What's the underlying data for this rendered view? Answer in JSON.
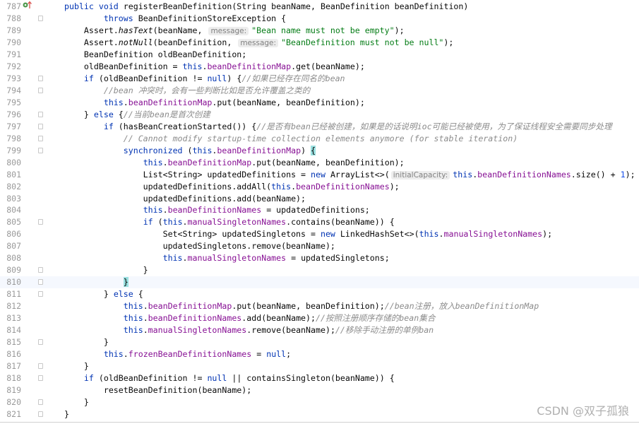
{
  "editor": {
    "colors": {
      "keyword": "#0033b3",
      "field": "#871094",
      "string": "#067d17",
      "comment": "#8c8c8c",
      "number": "#1750eb",
      "brace_match": "#99e0e0"
    },
    "current_line": 810,
    "lines": [
      {
        "n": "787",
        "icon": "override-implements-icon",
        "tokens": [
          [
            "k",
            "public void "
          ],
          [
            "t",
            "registerBeanDefinition(String beanName, BeanDefinition beanDefinition)"
          ]
        ]
      },
      {
        "n": "788",
        "fold": true,
        "tokens": [
          [
            "t",
            "        "
          ],
          [
            "k",
            "throws "
          ],
          [
            "t",
            "BeanDefinitionStoreException {"
          ]
        ]
      },
      {
        "n": "789",
        "tokens": [
          [
            "t",
            "    Assert."
          ],
          [
            "i",
            "hasText"
          ],
          [
            "t",
            "(beanName, "
          ],
          [
            "h",
            "message:"
          ],
          [
            "s",
            "\"Bean name must not be empty\""
          ],
          [
            "t",
            ");"
          ]
        ]
      },
      {
        "n": "790",
        "tokens": [
          [
            "t",
            "    Assert."
          ],
          [
            "i",
            "notNull"
          ],
          [
            "t",
            "(beanDefinition, "
          ],
          [
            "h",
            "message:"
          ],
          [
            "s",
            "\"BeanDefinition must not be null\""
          ],
          [
            "t",
            ");"
          ]
        ]
      },
      {
        "n": "791",
        "tokens": [
          [
            "t",
            "    BeanDefinition oldBeanDefinition;"
          ]
        ]
      },
      {
        "n": "792",
        "tokens": [
          [
            "t",
            "    oldBeanDefinition = "
          ],
          [
            "k",
            "this"
          ],
          [
            "t",
            "."
          ],
          [
            "f",
            "beanDefinitionMap"
          ],
          [
            "t",
            ".get(beanName);"
          ]
        ]
      },
      {
        "n": "793",
        "fold": true,
        "tokens": [
          [
            "t",
            "    "
          ],
          [
            "k",
            "if"
          ],
          [
            "t",
            " (oldBeanDefinition != "
          ],
          [
            "k",
            "null"
          ],
          [
            "t",
            ") {"
          ],
          [
            "c",
            "//如果已经存在同名的bean"
          ]
        ]
      },
      {
        "n": "794",
        "fold": true,
        "tokens": [
          [
            "t",
            "        "
          ],
          [
            "c",
            "//bean 冲突时，会有一些判断比如是否允许覆盖之类的"
          ]
        ]
      },
      {
        "n": "795",
        "tokens": [
          [
            "t",
            "        "
          ],
          [
            "k",
            "this"
          ],
          [
            "t",
            "."
          ],
          [
            "f",
            "beanDefinitionMap"
          ],
          [
            "t",
            ".put(beanName, beanDefinition);"
          ]
        ]
      },
      {
        "n": "796",
        "fold": true,
        "tokens": [
          [
            "t",
            "    } "
          ],
          [
            "k",
            "else"
          ],
          [
            "t",
            " {"
          ],
          [
            "c",
            "//当前bean是首次创建"
          ]
        ]
      },
      {
        "n": "797",
        "fold": true,
        "tokens": [
          [
            "t",
            "        "
          ],
          [
            "k",
            "if"
          ],
          [
            "t",
            " (hasBeanCreationStarted()) {"
          ],
          [
            "c",
            "//是否有bean已经被创建，如果是的话说明ioc可能已经被使用，为了保证线程安全需要同步处理"
          ]
        ]
      },
      {
        "n": "798",
        "fold": true,
        "tokens": [
          [
            "t",
            "            "
          ],
          [
            "c",
            "// Cannot modify startup-time collection elements anymore (for stable iteration)"
          ]
        ]
      },
      {
        "n": "799",
        "fold": true,
        "tokens": [
          [
            "t",
            "            "
          ],
          [
            "k",
            "synchronized"
          ],
          [
            "t",
            " ("
          ],
          [
            "k",
            "this"
          ],
          [
            "t",
            "."
          ],
          [
            "f",
            "beanDefinitionMap"
          ],
          [
            "t",
            ") "
          ],
          [
            "b",
            "{"
          ]
        ]
      },
      {
        "n": "800",
        "tokens": [
          [
            "t",
            "                "
          ],
          [
            "k",
            "this"
          ],
          [
            "t",
            "."
          ],
          [
            "f",
            "beanDefinitionMap"
          ],
          [
            "t",
            ".put(beanName, beanDefinition);"
          ]
        ]
      },
      {
        "n": "801",
        "tokens": [
          [
            "t",
            "                List<String> updatedDefinitions = "
          ],
          [
            "k",
            "new"
          ],
          [
            "t",
            " ArrayList<>("
          ],
          [
            "h",
            "initialCapacity:"
          ],
          [
            "k",
            "this"
          ],
          [
            "t",
            "."
          ],
          [
            "f",
            "beanDefinitionNames"
          ],
          [
            "t",
            ".size() + "
          ],
          [
            "n",
            "1"
          ],
          [
            "t",
            ");"
          ]
        ]
      },
      {
        "n": "802",
        "tokens": [
          [
            "t",
            "                updatedDefinitions.addAll("
          ],
          [
            "k",
            "this"
          ],
          [
            "t",
            "."
          ],
          [
            "f",
            "beanDefinitionNames"
          ],
          [
            "t",
            ");"
          ]
        ]
      },
      {
        "n": "803",
        "tokens": [
          [
            "t",
            "                updatedDefinitions.add(beanName);"
          ]
        ]
      },
      {
        "n": "804",
        "tokens": [
          [
            "t",
            "                "
          ],
          [
            "k",
            "this"
          ],
          [
            "t",
            "."
          ],
          [
            "f",
            "beanDefinitionNames"
          ],
          [
            "t",
            " = updatedDefinitions;"
          ]
        ]
      },
      {
        "n": "805",
        "fold": true,
        "tokens": [
          [
            "t",
            "                "
          ],
          [
            "k",
            "if"
          ],
          [
            "t",
            " ("
          ],
          [
            "k",
            "this"
          ],
          [
            "t",
            "."
          ],
          [
            "f",
            "manualSingletonNames"
          ],
          [
            "t",
            ".contains(beanName)) {"
          ]
        ]
      },
      {
        "n": "806",
        "tokens": [
          [
            "t",
            "                    Set<String> updatedSingletons = "
          ],
          [
            "k",
            "new"
          ],
          [
            "t",
            " LinkedHashSet<>("
          ],
          [
            "k",
            "this"
          ],
          [
            "t",
            "."
          ],
          [
            "f",
            "manualSingletonNames"
          ],
          [
            "t",
            ");"
          ]
        ]
      },
      {
        "n": "807",
        "tokens": [
          [
            "t",
            "                    updatedSingletons.remove(beanName);"
          ]
        ]
      },
      {
        "n": "808",
        "tokens": [
          [
            "t",
            "                    "
          ],
          [
            "k",
            "this"
          ],
          [
            "t",
            "."
          ],
          [
            "f",
            "manualSingletonNames"
          ],
          [
            "t",
            " = updatedSingletons;"
          ]
        ]
      },
      {
        "n": "809",
        "fold": true,
        "tokens": [
          [
            "t",
            "                }"
          ]
        ]
      },
      {
        "n": "810",
        "fold": true,
        "tokens": [
          [
            "t",
            "            "
          ],
          [
            "b",
            "}"
          ]
        ]
      },
      {
        "n": "811",
        "fold": true,
        "tokens": [
          [
            "t",
            "        } "
          ],
          [
            "k",
            "else"
          ],
          [
            "t",
            " {"
          ]
        ]
      },
      {
        "n": "812",
        "tokens": [
          [
            "t",
            "            "
          ],
          [
            "k",
            "this"
          ],
          [
            "t",
            "."
          ],
          [
            "f",
            "beanDefinitionMap"
          ],
          [
            "t",
            ".put(beanName, beanDefinition);"
          ],
          [
            "c",
            "//bean注册，放入beanDefinitionMap"
          ]
        ]
      },
      {
        "n": "813",
        "tokens": [
          [
            "t",
            "            "
          ],
          [
            "k",
            "this"
          ],
          [
            "t",
            "."
          ],
          [
            "f",
            "beanDefinitionNames"
          ],
          [
            "t",
            ".add(beanName);"
          ],
          [
            "c",
            "//按照注册顺序存储的bean集合"
          ]
        ]
      },
      {
        "n": "814",
        "tokens": [
          [
            "t",
            "            "
          ],
          [
            "k",
            "this"
          ],
          [
            "t",
            "."
          ],
          [
            "f",
            "manualSingletonNames"
          ],
          [
            "t",
            ".remove(beanName);"
          ],
          [
            "c",
            "//移除手动注册的单例ban"
          ]
        ]
      },
      {
        "n": "815",
        "fold": true,
        "tokens": [
          [
            "t",
            "        }"
          ]
        ]
      },
      {
        "n": "816",
        "tokens": [
          [
            "t",
            "        "
          ],
          [
            "k",
            "this"
          ],
          [
            "t",
            "."
          ],
          [
            "f",
            "frozenBeanDefinitionNames"
          ],
          [
            "t",
            " = "
          ],
          [
            "k",
            "null"
          ],
          [
            "t",
            ";"
          ]
        ]
      },
      {
        "n": "817",
        "fold": true,
        "tokens": [
          [
            "t",
            "    }"
          ]
        ]
      },
      {
        "n": "818",
        "fold": true,
        "tokens": [
          [
            "t",
            "    "
          ],
          [
            "k",
            "if"
          ],
          [
            "t",
            " (oldBeanDefinition != "
          ],
          [
            "k",
            "null"
          ],
          [
            "t",
            " || containsSingleton(beanName)) {"
          ]
        ]
      },
      {
        "n": "819",
        "tokens": [
          [
            "t",
            "        resetBeanDefinition(beanName);"
          ]
        ]
      },
      {
        "n": "820",
        "fold": true,
        "tokens": [
          [
            "t",
            "    }"
          ]
        ]
      },
      {
        "n": "821",
        "fold": true,
        "tokens": [
          [
            "t",
            "}"
          ]
        ]
      }
    ]
  },
  "watermark": "CSDN @双子孤狼"
}
